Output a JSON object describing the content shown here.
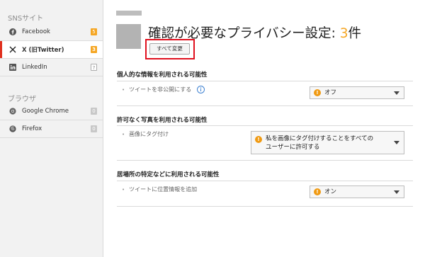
{
  "sidebar": {
    "sns_section": "SNSサイト",
    "browser_section": "ブラウザ",
    "sns_items": [
      {
        "label": "Facebook",
        "badge": "5",
        "icon": "facebook-icon"
      },
      {
        "label": "X (旧Twitter)",
        "badge": "3",
        "icon": "x-icon"
      },
      {
        "label": "LinkedIn",
        "badge": "?",
        "icon": "linkedin-icon"
      }
    ],
    "browser_items": [
      {
        "label": "Google Chrome",
        "badge": "0",
        "icon": "chrome-icon"
      },
      {
        "label": "Firefox",
        "badge": "0",
        "icon": "firefox-icon"
      }
    ]
  },
  "header": {
    "title_prefix": "確認が必要なプライバシー設定: ",
    "title_count": "3",
    "title_suffix": "件",
    "change_all_label": "すべて変更"
  },
  "sections": [
    {
      "heading": "個人的な情報を利用される可能性",
      "row_label": "ツイートを非公開にする",
      "select_value": "オフ"
    },
    {
      "heading": "許可なく写真を利用される可能性",
      "row_label": "画像にタグ付け",
      "select_value_line1": "私を画像にタグ付けすることをすべての",
      "select_value_line2": "ユーザーに許可する"
    },
    {
      "heading": "居場所の特定などに利用される可能性",
      "row_label": "ツイートに位置情報を追加",
      "select_value": "オン"
    }
  ],
  "colors": {
    "accent_orange": "#f5a623",
    "highlight_red": "#e0101e",
    "active_border": "#e0301e"
  }
}
